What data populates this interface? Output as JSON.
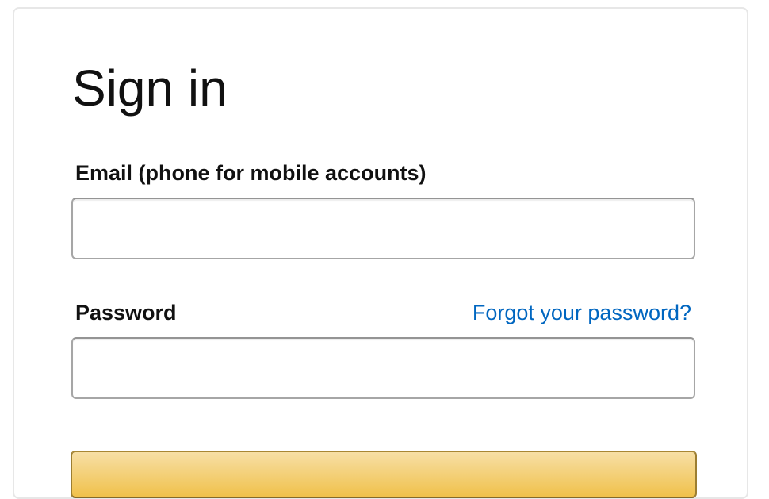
{
  "signin": {
    "title": "Sign in",
    "email_label": "Email (phone for mobile accounts)",
    "email_value": "",
    "password_label": "Password",
    "password_value": "",
    "forgot_link": "Forgot your password?"
  },
  "colors": {
    "link": "#0066c0",
    "button_top": "#f7dfa5",
    "button_bottom": "#f0c14b",
    "button_border": "#a88734",
    "field_border": "#a6a6a6",
    "card_border": "#e7e7e7"
  }
}
